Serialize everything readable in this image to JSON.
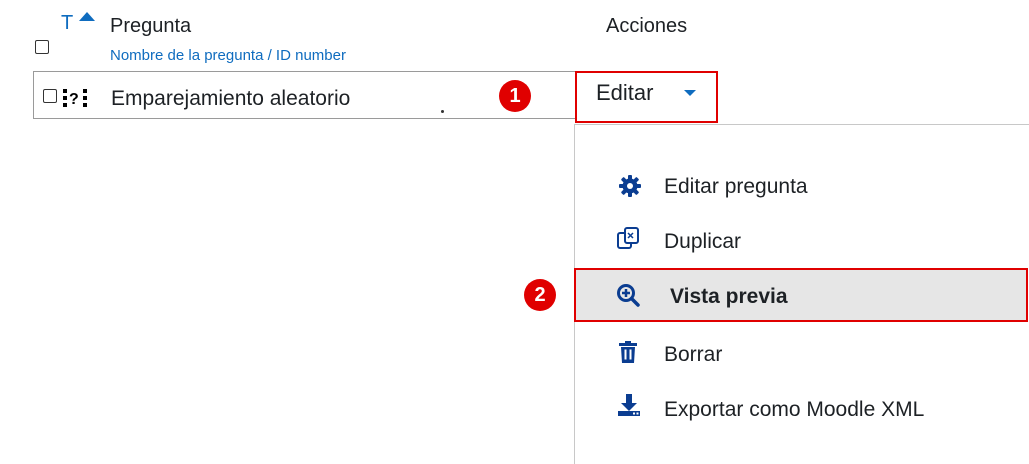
{
  "header": {
    "sort_label": "T",
    "question_label": "Pregunta",
    "question_sub": "Nombre de la pregunta / ID number",
    "actions_label": "Acciones"
  },
  "row": {
    "name": "Emparejamiento aleatorio",
    "type_icon": "random-match-icon"
  },
  "markers": {
    "one": "1",
    "two": "2"
  },
  "editar_button": {
    "label": "Editar"
  },
  "menu": {
    "items": [
      {
        "label": "Editar pregunta",
        "icon": "gear-icon"
      },
      {
        "label": "Duplicar",
        "icon": "duplicate-icon"
      },
      {
        "label": "Vista previa",
        "icon": "zoom-in-icon",
        "highlighted": true
      },
      {
        "label": "Borrar",
        "icon": "trash-icon"
      },
      {
        "label": "Exportar como Moodle XML",
        "icon": "download-icon"
      }
    ]
  },
  "colors": {
    "link": "#0f6cbf",
    "icon": "#0b3d91",
    "marker": "#e00000",
    "highlight_bg": "#e6e6e6"
  }
}
